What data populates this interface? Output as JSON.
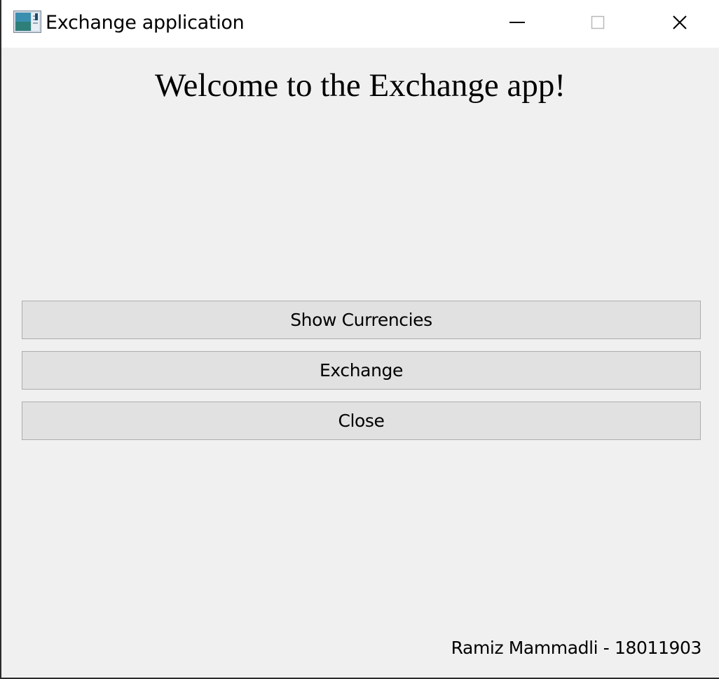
{
  "window": {
    "title": "Exchange application",
    "icon": "app-window-icon",
    "controls": {
      "minimize": "minimize-icon",
      "maximize": "maximize-icon",
      "close": "close-icon"
    }
  },
  "main": {
    "heading": "Welcome to the Exchange app!",
    "buttons": {
      "show_currencies": "Show Currencies",
      "exchange": "Exchange",
      "close": "Close"
    },
    "footer": "Ramiz Mammadli - 18011903"
  },
  "colors": {
    "background": "#f0f0f0",
    "titlebar": "#ffffff",
    "button_face": "#e1e1e1",
    "button_border": "#adadad"
  }
}
